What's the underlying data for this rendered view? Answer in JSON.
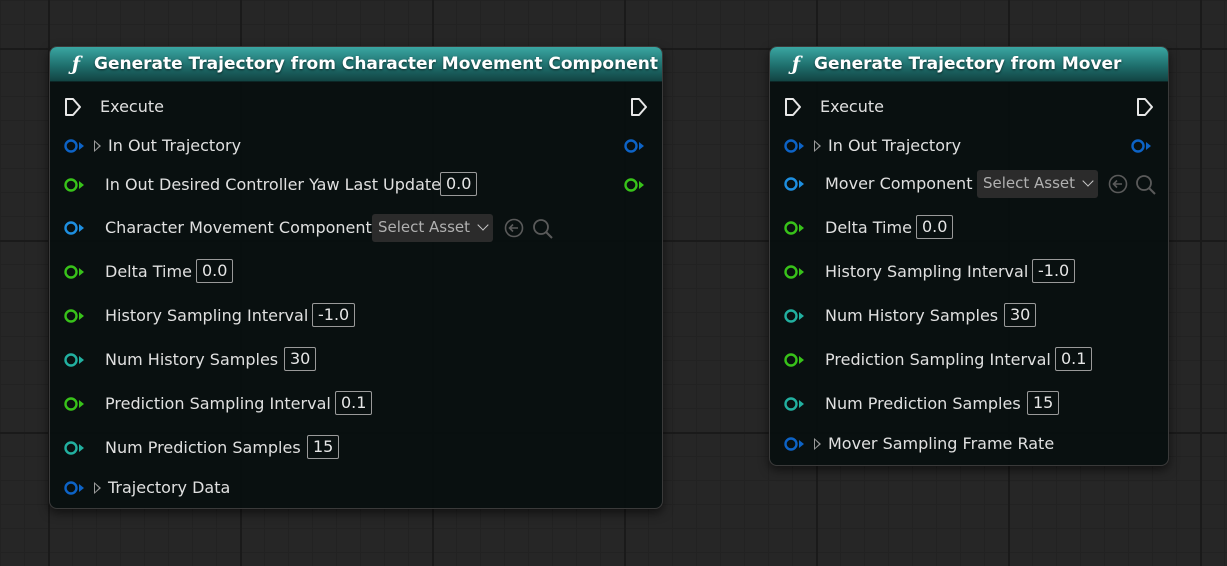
{
  "colors": {
    "exec_pin": "#e8e8e8",
    "struct_pin": "#0d63c6",
    "float_pin": "#38c21a",
    "int_pin": "#22b0a0",
    "object_pin": "#1e8fe0",
    "header_teal": "#2a8a88"
  },
  "left_node": {
    "icon": "function-icon",
    "title": "Generate Trajectory from Character Movement Component",
    "execute_label": "Execute",
    "in_out_trajectory": "In Out Trajectory",
    "desired_yaw_label": "In Out Desired Controller Yaw Last Update",
    "desired_yaw_value": "0.0",
    "cmc_label": "Character Movement Component",
    "cmc_select": "Select Asset",
    "delta_time_label": "Delta Time",
    "delta_time_value": "0.0",
    "history_interval_label": "History Sampling Interval",
    "history_interval_value": "-1.0",
    "num_history_label": "Num History Samples",
    "num_history_value": "30",
    "prediction_interval_label": "Prediction Sampling Interval",
    "prediction_interval_value": "0.1",
    "num_prediction_label": "Num Prediction Samples",
    "num_prediction_value": "15",
    "trajectory_data_label": "Trajectory Data"
  },
  "right_node": {
    "icon": "function-icon",
    "title": "Generate Trajectory from Mover",
    "execute_label": "Execute",
    "in_out_trajectory": "In Out Trajectory",
    "mover_component_label": "Mover Component",
    "mover_select": "Select Asset",
    "delta_time_label": "Delta Time",
    "delta_time_value": "0.0",
    "history_interval_label": "History Sampling Interval",
    "history_interval_value": "-1.0",
    "num_history_label": "Num History Samples",
    "num_history_value": "30",
    "prediction_interval_label": "Prediction Sampling Interval",
    "prediction_interval_value": "0.1",
    "num_prediction_label": "Num Prediction Samples",
    "num_prediction_value": "15",
    "mover_frame_rate_label": "Mover Sampling Frame Rate"
  }
}
